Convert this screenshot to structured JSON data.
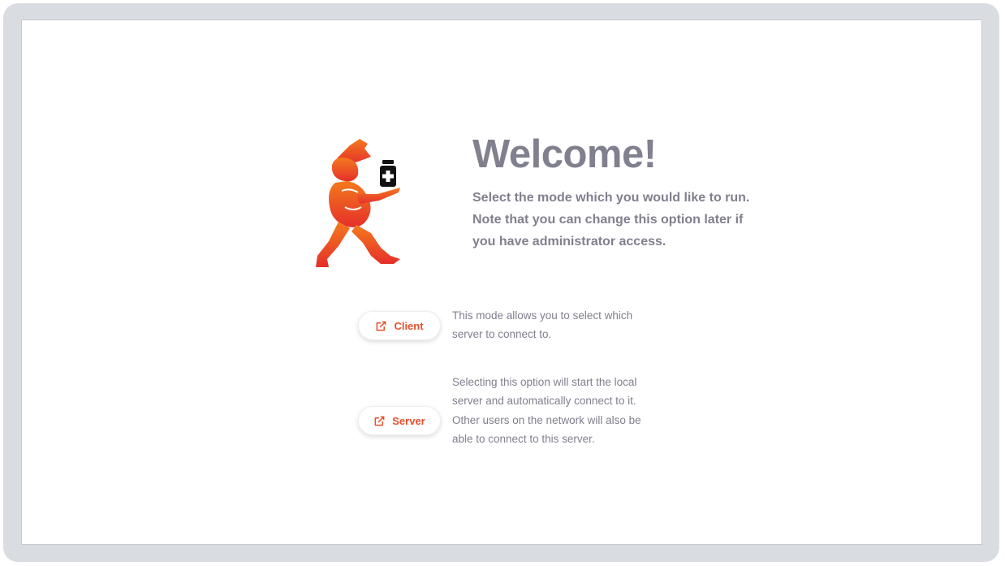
{
  "welcome": {
    "title": "Welcome!",
    "description": "Select the mode which you would like to run. Note that you can change this option later if you have administrator access."
  },
  "modes": [
    {
      "label": "Client",
      "icon": "external-link-icon",
      "description": "This mode allows you to select which server to connect to."
    },
    {
      "label": "Server",
      "icon": "external-link-icon",
      "description": "Selecting this option will start the local server and automatically connect to it. Other users on the network will also be able to connect to this server."
    }
  ],
  "colors": {
    "accent": "#e1512e",
    "text": "#80808f",
    "frame": "#d9dce1",
    "logo_top": "#f26a1b",
    "logo_bottom": "#e8302a"
  },
  "logo": {
    "icon": "pharmacist-running-with-medicine-bottle-icon"
  }
}
